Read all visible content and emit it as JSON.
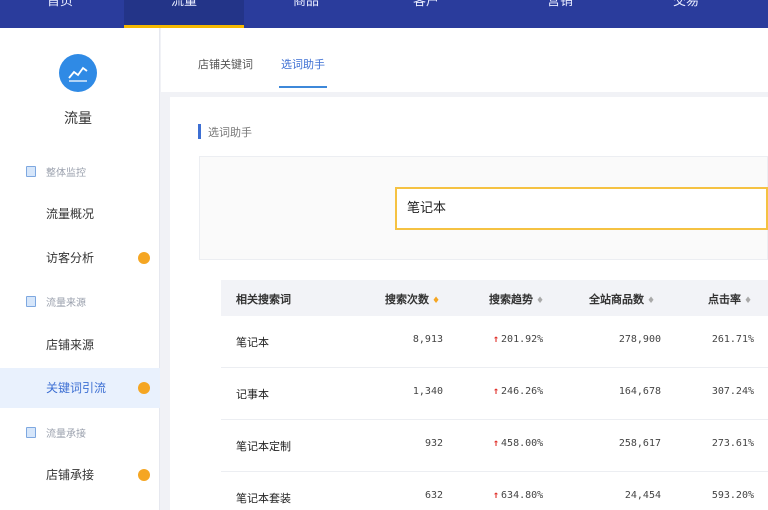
{
  "topnav": {
    "items": [
      {
        "label": "首页"
      },
      {
        "label": "流量"
      },
      {
        "label": "商品"
      },
      {
        "label": "客户"
      },
      {
        "label": "营销"
      },
      {
        "label": "交易"
      }
    ],
    "active_index": 1
  },
  "sidebar": {
    "title": "流量",
    "groups": [
      {
        "label": "整体监控",
        "items": [
          {
            "label": "流量概况"
          },
          {
            "label": "访客分析"
          }
        ]
      },
      {
        "label": "流量来源",
        "items": [
          {
            "label": "店铺来源"
          },
          {
            "label": "关键词引流"
          }
        ]
      },
      {
        "label": "流量承接",
        "items": [
          {
            "label": "店铺承接"
          }
        ]
      }
    ]
  },
  "tabs": [
    {
      "label": "店铺关键词"
    },
    {
      "label": "选词助手"
    }
  ],
  "section": {
    "title": "选词助手"
  },
  "search": {
    "value": "笔记本"
  },
  "table": {
    "headers": [
      "相关搜索词",
      "搜索次数",
      "搜索趋势",
      "全站商品数",
      "点击率"
    ],
    "rows": [
      {
        "keyword": "笔记本",
        "searches": "8,913",
        "trend": "201.92%",
        "products": "278,900",
        "ctr": "261.71%"
      },
      {
        "keyword": "记事本",
        "searches": "1,340",
        "trend": "246.26%",
        "products": "164,678",
        "ctr": "307.24%"
      },
      {
        "keyword": "笔记本定制",
        "searches": "932",
        "trend": "458.00%",
        "products": "258,617",
        "ctr": "273.61%"
      },
      {
        "keyword": "笔记本套装",
        "searches": "632",
        "trend": "634.80%",
        "products": "24,454",
        "ctr": "593.20%"
      }
    ]
  },
  "colors": {
    "nav_bg": "#2a3c9c",
    "accent_yellow": "#f5b800",
    "link_blue": "#3d6fd3",
    "badge_orange": "#f5a623",
    "trend_up_red": "#e0302a"
  },
  "icons": {
    "logo": "line-chart-icon",
    "group": "document-icon",
    "trend": "arrow-up-icon",
    "sort": "sort-caret-icon"
  }
}
